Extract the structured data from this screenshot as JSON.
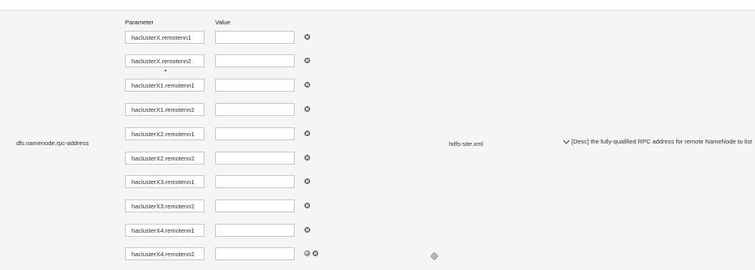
{
  "row": {
    "parameter_name": "dfs.namenode.rpc-address",
    "column_headers": {
      "parameter": "Parameter",
      "value": "Value"
    },
    "pairs": [
      {
        "key": "haclusterX.remotenn1",
        "value": ""
      },
      {
        "key": "haclusterX.remotenn2",
        "value": ""
      },
      {
        "key": "haclusterX1.remotenn1",
        "value": ""
      },
      {
        "key": "haclusterX1.remotenn2",
        "value": ""
      },
      {
        "key": "haclusterX2.remotenn1",
        "value": ""
      },
      {
        "key": "haclusterX2.remotenn2",
        "value": ""
      },
      {
        "key": "haclusterX3.remotenn1",
        "value": ""
      },
      {
        "key": "haclusterX3.remotenn2",
        "value": ""
      },
      {
        "key": "haclusterX4.remotenn1",
        "value": ""
      },
      {
        "key": "haclusterX4.remotenn2",
        "value": ""
      }
    ],
    "file": "hdfs-site.xml",
    "description": "[Desc] the fully-qualified RPC address for remote NameNode to list"
  },
  "icons": {
    "delete": "close-circle-icon",
    "add": "add-circle-icon",
    "settings": "gear-icon",
    "expand": "chevron-down-icon"
  }
}
